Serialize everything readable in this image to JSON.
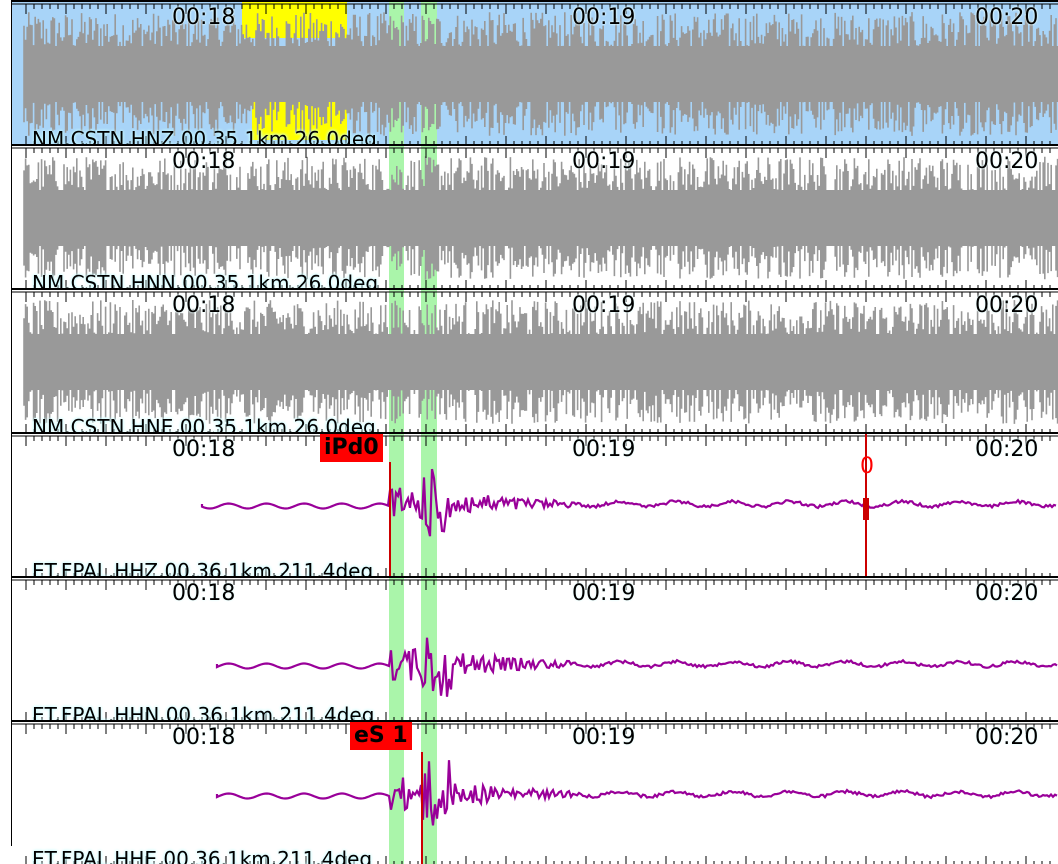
{
  "panels": [
    {
      "channel": "NM.CSTN.HNZ.00.35.1km.26.0deg",
      "times": [
        "00:18",
        "00:19",
        "00:20"
      ],
      "trace_style": "noise",
      "selected": true,
      "background": "#a8d4f8",
      "highlight": "#ffff00"
    },
    {
      "channel": "NM.CSTN.HNN.00.35.1km.26.0deg",
      "times": [
        "00:18",
        "00:19",
        "00:20"
      ],
      "trace_style": "noise",
      "selected": false,
      "background": "#ffffff"
    },
    {
      "channel": "NM.CSTN.HNE.00.35.1km.26.0deg",
      "times": [
        "00:18",
        "00:19",
        "00:20"
      ],
      "trace_style": "noise",
      "selected": false,
      "background": "#ffffff"
    },
    {
      "channel": "ET.FPAL.HHZ.00.36.1km.211.4deg",
      "times": [
        "00:18",
        "00:19",
        "00:20"
      ],
      "trace_style": "event",
      "pick": "iPd0",
      "marker": "0",
      "background": "#ffffff"
    },
    {
      "channel": "ET.FPAL.HHN.00.36.1km.211.4deg",
      "times": [
        "00:18",
        "00:19",
        "00:20"
      ],
      "trace_style": "event",
      "background": "#ffffff"
    },
    {
      "channel": "ET.FPAL.HHE.00.36.1km.211.4deg",
      "times": [
        "00:18",
        "00:19",
        "00:20"
      ],
      "trace_style": "event",
      "pick": "eS 1",
      "background": "#ffffff"
    }
  ],
  "colors": {
    "noise_trace": "#999999",
    "event_trace": "#990099",
    "pick_window": "#aaf5aa",
    "pick_line": "#cc0000",
    "pick_label_bg": "#ff0000"
  }
}
